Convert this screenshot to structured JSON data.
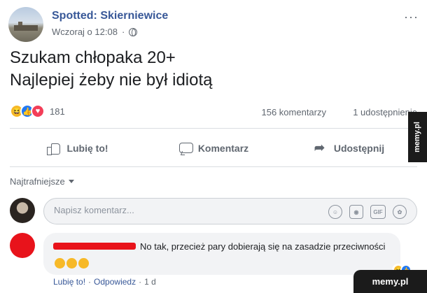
{
  "post": {
    "page_name": "Spotted: Skierniewice",
    "timestamp": "Wczoraj o 12:08",
    "more_label": "···",
    "text_line1": "Szukam chłopaka 20+",
    "text_line2": "Najlepiej żeby nie był idiotą",
    "reaction_count": "181",
    "comments_count": "156 komentarzy",
    "shares_count": "1 udostępnienie",
    "reactions": [
      "haha",
      "like",
      "love"
    ]
  },
  "actions": {
    "like_label": "Lubię to!",
    "comment_label": "Komentarz",
    "share_label": "Udostępnij"
  },
  "comments": {
    "sort_label": "Najtrafniejsze",
    "input_placeholder": "Napisz komentarz...",
    "input_icons": [
      "emoji-icon",
      "camera-icon",
      "gif-icon",
      "sticker-icon"
    ],
    "gif_label": "GIF",
    "first_comment": {
      "text": "No tak, przecież pary dobierają się na zasadzie przeciwności",
      "like_label": "Lubię to!",
      "reply_label": "Odpowiedz",
      "separator": "·",
      "time": "1 d"
    }
  },
  "watermark": {
    "side": "memy.pl",
    "corner": "memy.pl"
  },
  "colors": {
    "link": "#385898",
    "muted": "#606770",
    "haha": "#f7b928",
    "like": "#2078f4",
    "love": "#f33e58",
    "redaction": "#e8131b"
  }
}
